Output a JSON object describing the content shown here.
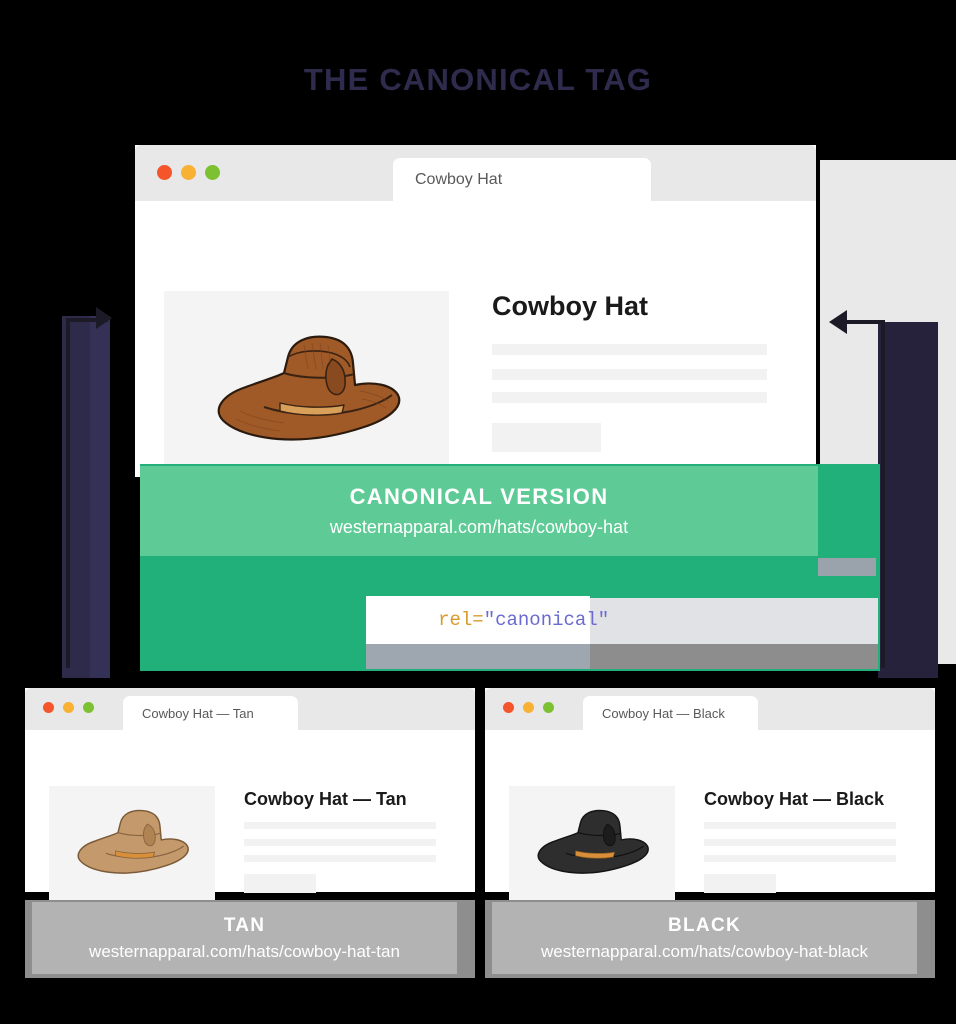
{
  "page": {
    "title": "THE CANONICAL TAG",
    "title_color": "#2e2b4d",
    "background_color": "#000000"
  },
  "colors": {
    "accent_green_light": "#5ecb96",
    "accent_green_dark": "#22b07a",
    "banner_gray": "#b3b3b3",
    "banner_gray_dark": "#8e8e8e",
    "navy": "#2d2a4a",
    "titlebar_gray": "#e8e8e8",
    "dot_red": "#f4552a",
    "dot_yellow": "#f8b133",
    "dot_green": "#7dc133"
  },
  "main_window": {
    "tab_label": "Cowboy Hat",
    "product_title": "Cowboy Hat",
    "hat_color_name": "brown",
    "hat_fill": "#a05a28",
    "hat_band": "#d9a05a",
    "dots": [
      "traffic-light-red",
      "traffic-light-yellow",
      "traffic-light-green"
    ],
    "banner": {
      "label": "CANONICAL VERSION",
      "url": "westernapparal.com/hats/cowboy-hat"
    },
    "code_snippet": {
      "attribute": "rel=",
      "value": "\"canonical\"",
      "attribute_color": "#d99a2b",
      "value_color": "#6a6ad1"
    }
  },
  "tan_window": {
    "tab_label": "Cowboy Hat — Tan",
    "product_title": "Cowboy Hat — Tan",
    "hat_color_name": "tan",
    "hat_fill": "#c49a6c",
    "hat_band": "#d98f3a",
    "banner": {
      "label": "TAN",
      "url": "westernapparal.com/hats/cowboy-hat-tan"
    }
  },
  "black_window": {
    "tab_label": "Cowboy Hat — Black",
    "product_title": "Cowboy Hat — Black",
    "hat_color_name": "black",
    "hat_fill": "#2e2e2e",
    "hat_band": "#d98f3a",
    "banner": {
      "label": "BLACK",
      "url": "westernapparal.com/hats/cowboy-hat-black"
    }
  },
  "arrows": {
    "left_arrow": "arrow-right-icon",
    "right_arrow": "arrow-left-icon"
  }
}
